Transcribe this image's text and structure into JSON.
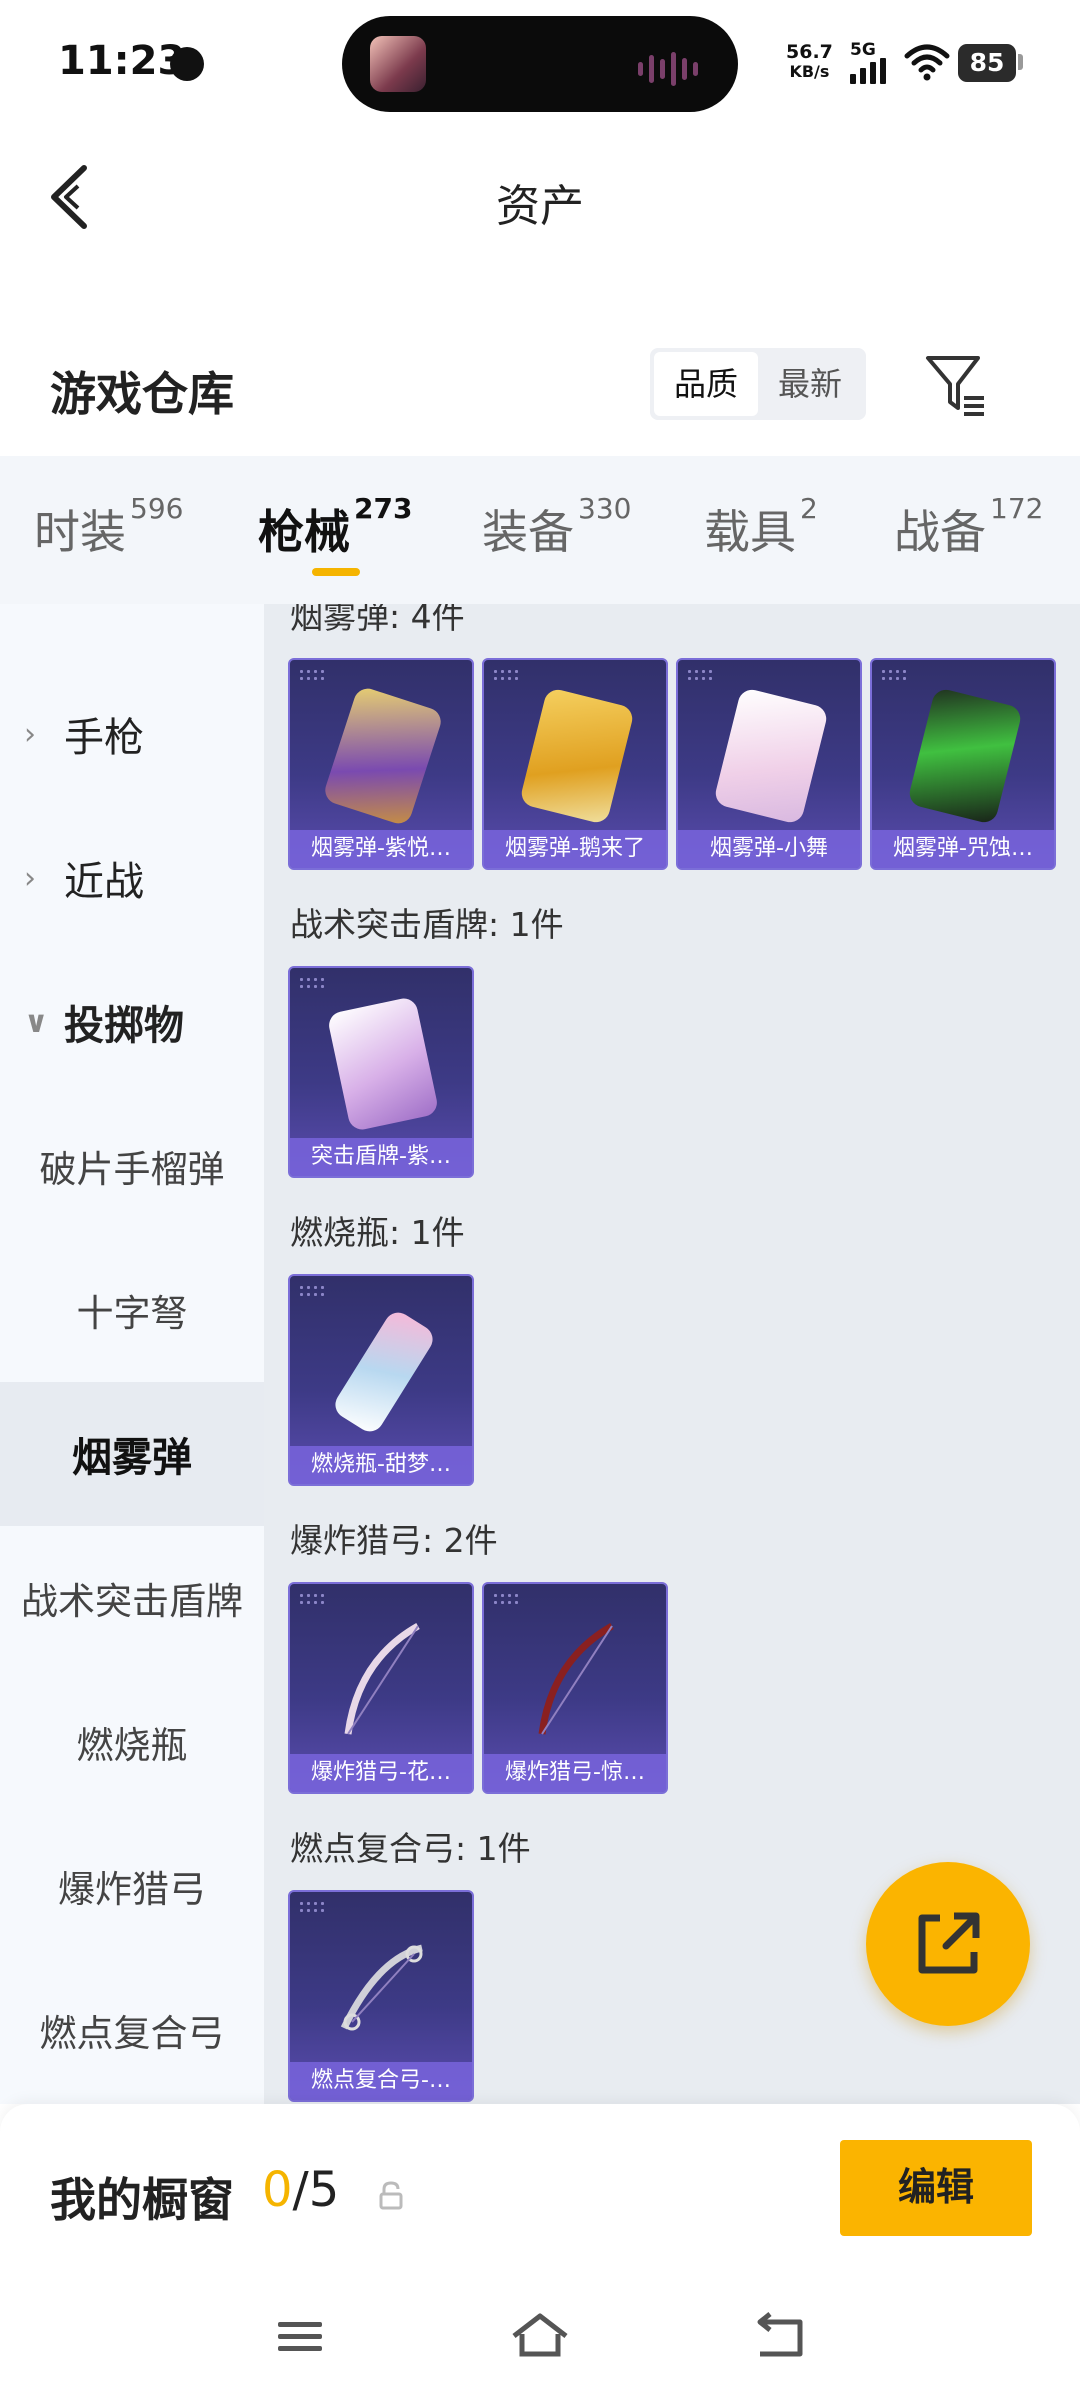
{
  "status_bar": {
    "time": "11:23",
    "net_speed_value": "56.7",
    "net_speed_unit": "KB/s",
    "network": "5G",
    "battery": "85"
  },
  "header": {
    "title": "资产",
    "back_icon": "chevron-left-icon"
  },
  "warehouse": {
    "title": "游戏仓库",
    "sort_options": [
      "品质",
      "最新"
    ],
    "active_sort": "品质",
    "filter_icon": "filter-icon"
  },
  "tabs": [
    {
      "label": "时装",
      "count": "596"
    },
    {
      "label": "枪械",
      "count": "273"
    },
    {
      "label": "装备",
      "count": "330"
    },
    {
      "label": "载具",
      "count": "2"
    },
    {
      "label": "战备",
      "count": "172"
    }
  ],
  "active_tab": "枪械",
  "side_menu": {
    "groups": [
      {
        "label": "手枪",
        "expanded": false
      },
      {
        "label": "近战",
        "expanded": false
      },
      {
        "label": "投掷物",
        "expanded": true
      }
    ],
    "sub_items": [
      "破片手榴弹",
      "十字弩",
      "烟雾弹",
      "战术突击盾牌",
      "燃烧瓶",
      "爆炸猎弓",
      "燃点复合弓"
    ],
    "active_item": "烟雾弹"
  },
  "sections": [
    {
      "title": "烟雾弹: 4件",
      "items": [
        "烟雾弹-紫悦…",
        "烟雾弹-鹅来了",
        "烟雾弹-小舞",
        "烟雾弹-咒蚀…"
      ]
    },
    {
      "title": "战术突击盾牌: 1件",
      "items": [
        "突击盾牌-紫…"
      ]
    },
    {
      "title": "燃烧瓶: 1件",
      "items": [
        "燃烧瓶-甜梦…"
      ]
    },
    {
      "title": "爆炸猎弓: 2件",
      "items": [
        "爆炸猎弓-花…",
        "爆炸猎弓-惊…"
      ]
    },
    {
      "title": "燃点复合弓: 1件",
      "items": [
        "燃点复合弓-…"
      ]
    }
  ],
  "share_button_icon": "share-external-icon",
  "showcase": {
    "label": "我的橱窗",
    "current": "0",
    "max": "/5",
    "edit_label": "编辑"
  },
  "nav_bar": {
    "icons": [
      "menu-icon",
      "home-icon",
      "back-icon"
    ]
  },
  "colors": {
    "accent": "#fbb400",
    "card_bg": "#3d3a86",
    "card_caption": "#7864dc",
    "content_bg": "#e8ecf1",
    "side_bg": "#f6f9fd"
  }
}
